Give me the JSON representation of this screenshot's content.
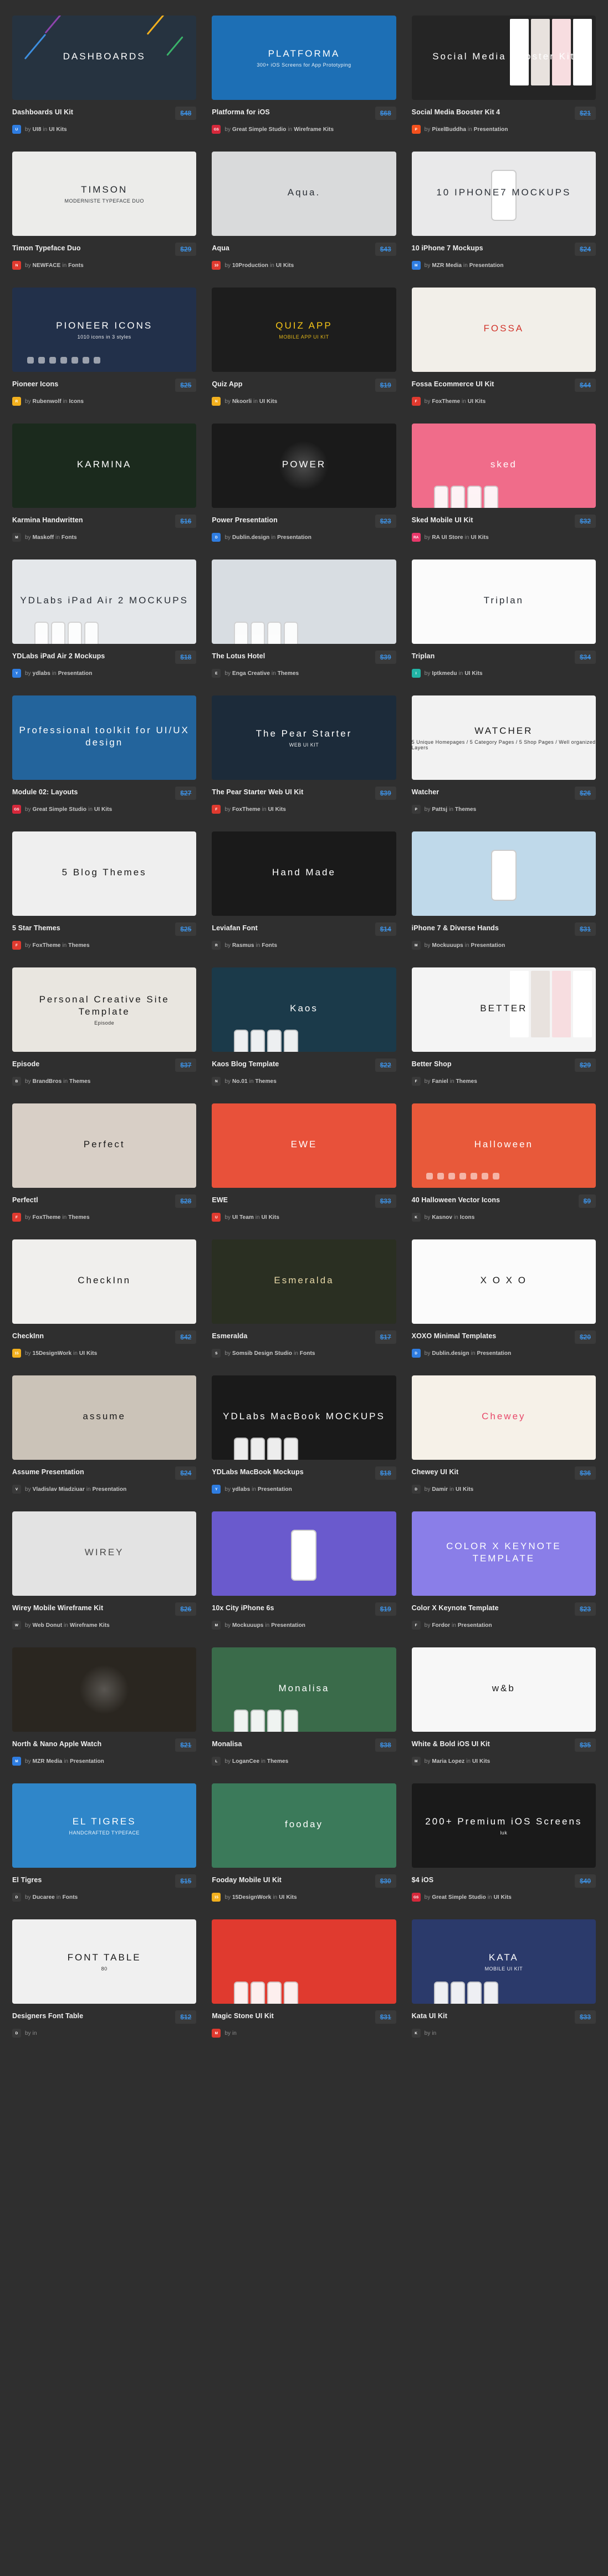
{
  "page": {
    "background": "#2f2f2f",
    "accent": "#3d8fe0",
    "columns": 3
  },
  "labels": {
    "by": "by",
    "in": "in"
  },
  "cards": [
    {
      "title": "Dashboards UI Kit",
      "price": "$48",
      "author": "UI8",
      "category": "UI Kits",
      "avatar_text": "U",
      "avatar_bg": "#2f7de1",
      "thumb": {
        "label": "DASHBOARDS",
        "sub": "",
        "bg": "#263340",
        "fg": "#ffffff",
        "style": "streaks"
      }
    },
    {
      "title": "Platforma for iOS",
      "price": "$68",
      "author": "Great Simple Studio",
      "category": "Wireframe Kits",
      "avatar_text": "GS",
      "avatar_bg": "#d6283b",
      "thumb": {
        "label": "PLATFORMA",
        "sub": "300+ iOS Screens for App Prototyping",
        "bg": "#1d6fb5",
        "fg": "#ffffff",
        "style": "plain"
      }
    },
    {
      "title": "Social Media Booster Kit 4",
      "price": "$21",
      "author": "PixelBuddha",
      "category": "Presentation",
      "avatar_text": "P",
      "avatar_bg": "#f4511e",
      "thumb": {
        "label": "Social Media Booster Kit",
        "sub": "",
        "bg": "#252525",
        "fg": "#ffffff",
        "style": "collage"
      }
    },
    {
      "title": "Timon Typeface Duo",
      "price": "$29",
      "author": "NEWFACE",
      "category": "Fonts",
      "avatar_text": "N",
      "avatar_bg": "#e03a2f",
      "thumb": {
        "label": "TIMSON",
        "sub": "MODERNISTE TYPEFACE DUO",
        "bg": "#ececea",
        "fg": "#22262b",
        "style": "plain"
      }
    },
    {
      "title": "Aqua",
      "price": "$43",
      "author": "10Production",
      "category": "UI Kits",
      "avatar_text": "10",
      "avatar_bg": "#e03a2f",
      "thumb": {
        "label": "Aqua.",
        "sub": "",
        "bg": "#d9dadb",
        "fg": "#2a2f36",
        "style": "plain"
      }
    },
    {
      "title": "10 iPhone 7 Mockups",
      "price": "$24",
      "author": "MZR Media",
      "category": "Presentation",
      "avatar_text": "M",
      "avatar_bg": "#2f7de1",
      "thumb": {
        "label": "10 IPHONE7 MOCKUPS",
        "sub": "",
        "bg": "#e9e9ea",
        "fg": "#2a2f36",
        "style": "hand"
      }
    },
    {
      "title": "Pioneer Icons",
      "price": "$25",
      "author": "Rubenwolf",
      "category": "Icons",
      "avatar_text": "R",
      "avatar_bg": "#f2b01e",
      "thumb": {
        "label": "PIONEER ICONS",
        "sub": "1010 icons in 3 styles",
        "bg": "#22304a",
        "fg": "#ffffff",
        "style": "icons"
      }
    },
    {
      "title": "Quiz App",
      "price": "$19",
      "author": "Nkoorli",
      "category": "UI Kits",
      "avatar_text": "N",
      "avatar_bg": "#f2b01e",
      "thumb": {
        "label": "QUIZ APP",
        "sub": "MOBILE APP UI KIT",
        "bg": "#1d1d1d",
        "fg": "#f5c518",
        "style": "plain"
      }
    },
    {
      "title": "Fossa Ecommerce UI Kit",
      "price": "$44",
      "author": "FoxTheme",
      "category": "UI Kits",
      "avatar_text": "F",
      "avatar_bg": "#e03a2f",
      "thumb": {
        "label": "FOSSA",
        "sub": "",
        "bg": "#f2efe9",
        "fg": "#d2342b",
        "style": "plain"
      }
    },
    {
      "title": "Karmina Handwritten",
      "price": "$16",
      "author": "Maskoff",
      "category": "Fonts",
      "avatar_text": "M",
      "avatar_bg": "#3a3a3a",
      "thumb": {
        "label": "KARMINA",
        "sub": "",
        "bg": "#1b2a1d",
        "fg": "#ffffff",
        "style": "plain"
      }
    },
    {
      "title": "Power Presentation",
      "price": "$23",
      "author": "Dublin.design",
      "category": "Presentation",
      "avatar_text": "D",
      "avatar_bg": "#2f7de1",
      "thumb": {
        "label": "POWER",
        "sub": "",
        "bg": "#1a1a1a",
        "fg": "#ffffff",
        "style": "dark"
      }
    },
    {
      "title": "Sked Mobile UI Kit",
      "price": "$32",
      "author": "RA UI Store",
      "category": "UI Kits",
      "avatar_text": "RA",
      "avatar_bg": "#e8386a",
      "thumb": {
        "label": "sked",
        "sub": "",
        "bg": "#f06c8a",
        "fg": "#ffffff",
        "style": "phones"
      }
    },
    {
      "title": "YDLabs iPad Air 2 Mockups",
      "price": "$18",
      "author": "ydlabs",
      "category": "Presentation",
      "avatar_text": "Y",
      "avatar_bg": "#2f7de1",
      "thumb": {
        "label": "YDLabs iPad Air 2 MOCKUPS",
        "sub": "",
        "bg": "#e4e7ea",
        "fg": "#2a2f36",
        "style": "devices"
      }
    },
    {
      "title": "The Lotus Hotel",
      "price": "$39",
      "author": "Enga Creative",
      "category": "Themes",
      "avatar_text": "E",
      "avatar_bg": "#3a3a3a",
      "thumb": {
        "label": "",
        "sub": "",
        "bg": "#d8dde2",
        "fg": "#2a2f36",
        "style": "devices"
      }
    },
    {
      "title": "Triplan",
      "price": "$34",
      "author": "Iptkmedu",
      "category": "UI Kits",
      "avatar_text": "I",
      "avatar_bg": "#22b5a6",
      "thumb": {
        "label": "Triplan",
        "sub": "",
        "bg": "#fbfbfb",
        "fg": "#2a2f36",
        "style": "plain"
      }
    },
    {
      "title": "Module 02: Layouts",
      "price": "$27",
      "author": "Great Simple Studio",
      "category": "UI Kits",
      "avatar_text": "GS",
      "avatar_bg": "#d6283b",
      "thumb": {
        "label": "Professional toolkit for UI/UX design",
        "sub": "",
        "bg": "#23649c",
        "fg": "#ffffff",
        "style": "plain"
      }
    },
    {
      "title": "The Pear Starter Web UI Kit",
      "price": "$39",
      "author": "FoxTheme",
      "category": "UI Kits",
      "avatar_text": "F",
      "avatar_bg": "#e03a2f",
      "thumb": {
        "label": "The Pear Starter",
        "sub": "WEB UI KIT",
        "bg": "#1c2b3a",
        "fg": "#ffffff",
        "style": "plain"
      }
    },
    {
      "title": "Watcher",
      "price": "$26",
      "author": "Pattsj",
      "category": "Themes",
      "avatar_text": "P",
      "avatar_bg": "#3a3a3a",
      "thumb": {
        "label": "WATCHER",
        "sub": "5 Unique Homepages / 5 Category Pages / 5 Shop Pages / Well organized Layers",
        "bg": "#f2f2f2",
        "fg": "#1a1a1a",
        "style": "plain"
      }
    },
    {
      "title": "5 Star Themes",
      "price": "$25",
      "author": "FoxTheme",
      "category": "Themes",
      "avatar_text": "F",
      "avatar_bg": "#e03a2f",
      "thumb": {
        "label": "5 Blog Themes",
        "sub": "",
        "bg": "#efefef",
        "fg": "#1a1a1a",
        "style": "plain"
      }
    },
    {
      "title": "Leviafan Font",
      "price": "$14",
      "author": "Rasmus",
      "category": "Fonts",
      "avatar_text": "R",
      "avatar_bg": "#3a3a3a",
      "thumb": {
        "label": "Hand Made",
        "sub": "",
        "bg": "#1a1a1a",
        "fg": "#ffffff",
        "style": "plain"
      }
    },
    {
      "title": "iPhone 7 & Diverse Hands",
      "price": "$31",
      "author": "Mockuuups",
      "category": "Presentation",
      "avatar_text": "M",
      "avatar_bg": "#3a3a3a",
      "thumb": {
        "label": "",
        "sub": "",
        "bg": "#bfd9ea",
        "fg": "#2a2f36",
        "style": "hand"
      }
    },
    {
      "title": "Episode",
      "price": "$37",
      "author": "BrandBros",
      "category": "Themes",
      "avatar_text": "B",
      "avatar_bg": "#3a3a3a",
      "thumb": {
        "label": "Personal Creative Site Template",
        "sub": "Episode",
        "bg": "#e9e6e0",
        "fg": "#1a1a1a",
        "style": "plain"
      }
    },
    {
      "title": "Kaos Blog Template",
      "price": "$22",
      "author": "No.01",
      "category": "Themes",
      "avatar_text": "N",
      "avatar_bg": "#3a3a3a",
      "thumb": {
        "label": "Kaos",
        "sub": "",
        "bg": "#1b3a4a",
        "fg": "#ffffff",
        "style": "devices"
      }
    },
    {
      "title": "Better Shop",
      "price": "$29",
      "author": "Faniel",
      "category": "Themes",
      "avatar_text": "F",
      "avatar_bg": "#3a3a3a",
      "thumb": {
        "label": "BETTER",
        "sub": "",
        "bg": "#f4f4f4",
        "fg": "#1a1a1a",
        "style": "collage"
      }
    },
    {
      "title": "Perfectl",
      "price": "$28",
      "author": "FoxTheme",
      "category": "Themes",
      "avatar_text": "F",
      "avatar_bg": "#e03a2f",
      "thumb": {
        "label": "Perfect",
        "sub": "",
        "bg": "#d8cfc6",
        "fg": "#1a1a1a",
        "style": "plain"
      }
    },
    {
      "title": "EWE",
      "price": "$33",
      "author": "UI Team",
      "category": "UI Kits",
      "avatar_text": "U",
      "avatar_bg": "#e03a2f",
      "thumb": {
        "label": "EWE",
        "sub": "",
        "bg": "#e8513a",
        "fg": "#ffffff",
        "style": "plain"
      }
    },
    {
      "title": "40 Halloween Vector Icons",
      "price": "$9",
      "author": "Kasnov",
      "category": "Icons",
      "avatar_text": "K",
      "avatar_bg": "#3a3a3a",
      "thumb": {
        "label": "Halloween",
        "sub": "",
        "bg": "#e8593a",
        "fg": "#ffffff",
        "style": "icons"
      }
    },
    {
      "title": "CheckInn",
      "price": "$42",
      "author": "15DesignWork",
      "category": "UI Kits",
      "avatar_text": "15",
      "avatar_bg": "#f2b01e",
      "thumb": {
        "label": "CheckInn",
        "sub": "",
        "bg": "#f0efed",
        "fg": "#1a1a1a",
        "style": "plain"
      }
    },
    {
      "title": "Esmeralda",
      "price": "$17",
      "author": "Somsib Design Studio",
      "category": "Fonts",
      "avatar_text": "S",
      "avatar_bg": "#3a3a3a",
      "thumb": {
        "label": "Esmeralda",
        "sub": "",
        "bg": "#2a2f22",
        "fg": "#e8d9a8",
        "style": "plain"
      }
    },
    {
      "title": "XOXO Minimal Templates",
      "price": "$20",
      "author": "Dublin.design",
      "category": "Presentation",
      "avatar_text": "D",
      "avatar_bg": "#2f7de1",
      "thumb": {
        "label": "X O X O",
        "sub": "",
        "bg": "#fbfbfb",
        "fg": "#1a1a1a",
        "style": "plain"
      }
    },
    {
      "title": "Assume Presentation",
      "price": "$24",
      "author": "Vladislav Miadziuar",
      "category": "Presentation",
      "avatar_text": "V",
      "avatar_bg": "#3a3a3a",
      "thumb": {
        "label": "assume",
        "sub": "",
        "bg": "#cbc3b8",
        "fg": "#1a1a1a",
        "style": "plain"
      }
    },
    {
      "title": "YDLabs MacBook Mockups",
      "price": "$18",
      "author": "ydlabs",
      "category": "Presentation",
      "avatar_text": "Y",
      "avatar_bg": "#2f7de1",
      "thumb": {
        "label": "YDLabs MacBook MOCKUPS",
        "sub": "",
        "bg": "#1a1a1a",
        "fg": "#ffffff",
        "style": "devices"
      }
    },
    {
      "title": "Chewey UI Kit",
      "price": "$36",
      "author": "Damir",
      "category": "UI Kits",
      "avatar_text": "D",
      "avatar_bg": "#3a3a3a",
      "thumb": {
        "label": "Chewey",
        "sub": "",
        "bg": "#f6f1e8",
        "fg": "#e8486a",
        "style": "plain"
      }
    },
    {
      "title": "Wirey Mobile Wireframe Kit",
      "price": "$26",
      "author": "Web Donut",
      "category": "Wireframe Kits",
      "avatar_text": "W",
      "avatar_bg": "#3a3a3a",
      "thumb": {
        "label": "WIREY",
        "sub": "",
        "bg": "#e3e3e3",
        "fg": "#4a4a4a",
        "style": "plain"
      }
    },
    {
      "title": "10x City iPhone 6s",
      "price": "$19",
      "author": "Mockuuups",
      "category": "Presentation",
      "avatar_text": "M",
      "avatar_bg": "#3a3a3a",
      "thumb": {
        "label": "",
        "sub": "",
        "bg": "#6a5acd",
        "fg": "#ffffff",
        "style": "hand"
      }
    },
    {
      "title": "Color X Keynote Template",
      "price": "$23",
      "author": "Fordor",
      "category": "Presentation",
      "avatar_text": "F",
      "avatar_bg": "#3a3a3a",
      "thumb": {
        "label": "COLOR X KEYNOTE TEMPLATE",
        "sub": "",
        "bg": "#8a7ee8",
        "fg": "#ffffff",
        "style": "plain"
      }
    },
    {
      "title": "North & Nano Apple Watch",
      "price": "$21",
      "author": "MZR Media",
      "category": "Presentation",
      "avatar_text": "M",
      "avatar_bg": "#2f7de1",
      "thumb": {
        "label": "",
        "sub": "",
        "bg": "#2a2620",
        "fg": "#ffffff",
        "style": "dark"
      }
    },
    {
      "title": "Monalisa",
      "price": "$38",
      "author": "LoganCee",
      "category": "Themes",
      "avatar_text": "L",
      "avatar_bg": "#3a3a3a",
      "thumb": {
        "label": "Monalisa",
        "sub": "",
        "bg": "#3a6b4a",
        "fg": "#ffffff",
        "style": "devices"
      }
    },
    {
      "title": "White & Bold iOS UI Kit",
      "price": "$35",
      "author": "Maria Lopez",
      "category": "UI Kits",
      "avatar_text": "M",
      "avatar_bg": "#3a3a3a",
      "thumb": {
        "label": "w&b",
        "sub": "",
        "bg": "#f7f7f7",
        "fg": "#1a1a1a",
        "style": "plain"
      }
    },
    {
      "title": "El Tigres",
      "price": "$15",
      "author": "Ducaree",
      "category": "Fonts",
      "avatar_text": "D",
      "avatar_bg": "#3a3a3a",
      "thumb": {
        "label": "EL TIGRES",
        "sub": "HANDCRAFTED TYPEFACE",
        "bg": "#2f86c9",
        "fg": "#ffffff",
        "style": "plain"
      }
    },
    {
      "title": "Fooday Mobile UI Kit",
      "price": "$30",
      "author": "15DesignWork",
      "category": "UI Kits",
      "avatar_text": "15",
      "avatar_bg": "#f2b01e",
      "thumb": {
        "label": "fooday",
        "sub": "",
        "bg": "#3b7a5a",
        "fg": "#ffffff",
        "style": "plain"
      }
    },
    {
      "title": "$4 iOS",
      "price": "$40",
      "author": "Great Simple Studio",
      "category": "UI Kits",
      "avatar_text": "GS",
      "avatar_bg": "#d6283b",
      "thumb": {
        "label": "200+ Premium iOS Screens",
        "sub": "luk",
        "bg": "#1a1a1a",
        "fg": "#ffffff",
        "style": "plain"
      }
    },
    {
      "title": "Designers Font Table",
      "price": "$12",
      "author": "",
      "category": "",
      "avatar_text": "D",
      "avatar_bg": "#3a3a3a",
      "thumb": {
        "label": "FONT TABLE",
        "sub": "80",
        "bg": "#f0f0f0",
        "fg": "#1a1a1a",
        "style": "plain"
      }
    },
    {
      "title": "Magic Stone UI Kit",
      "price": "$31",
      "author": "",
      "category": "",
      "avatar_text": "M",
      "avatar_bg": "#e03a2f",
      "thumb": {
        "label": "",
        "sub": "",
        "bg": "#e03a2f",
        "fg": "#ffffff",
        "style": "devices"
      }
    },
    {
      "title": "Kata UI Kit",
      "price": "$33",
      "author": "",
      "category": "",
      "avatar_text": "K",
      "avatar_bg": "#3a3a3a",
      "thumb": {
        "label": "KATA",
        "sub": "MOBILE UI KIT",
        "bg": "#2b3a6b",
        "fg": "#ffffff",
        "style": "phones"
      }
    }
  ]
}
